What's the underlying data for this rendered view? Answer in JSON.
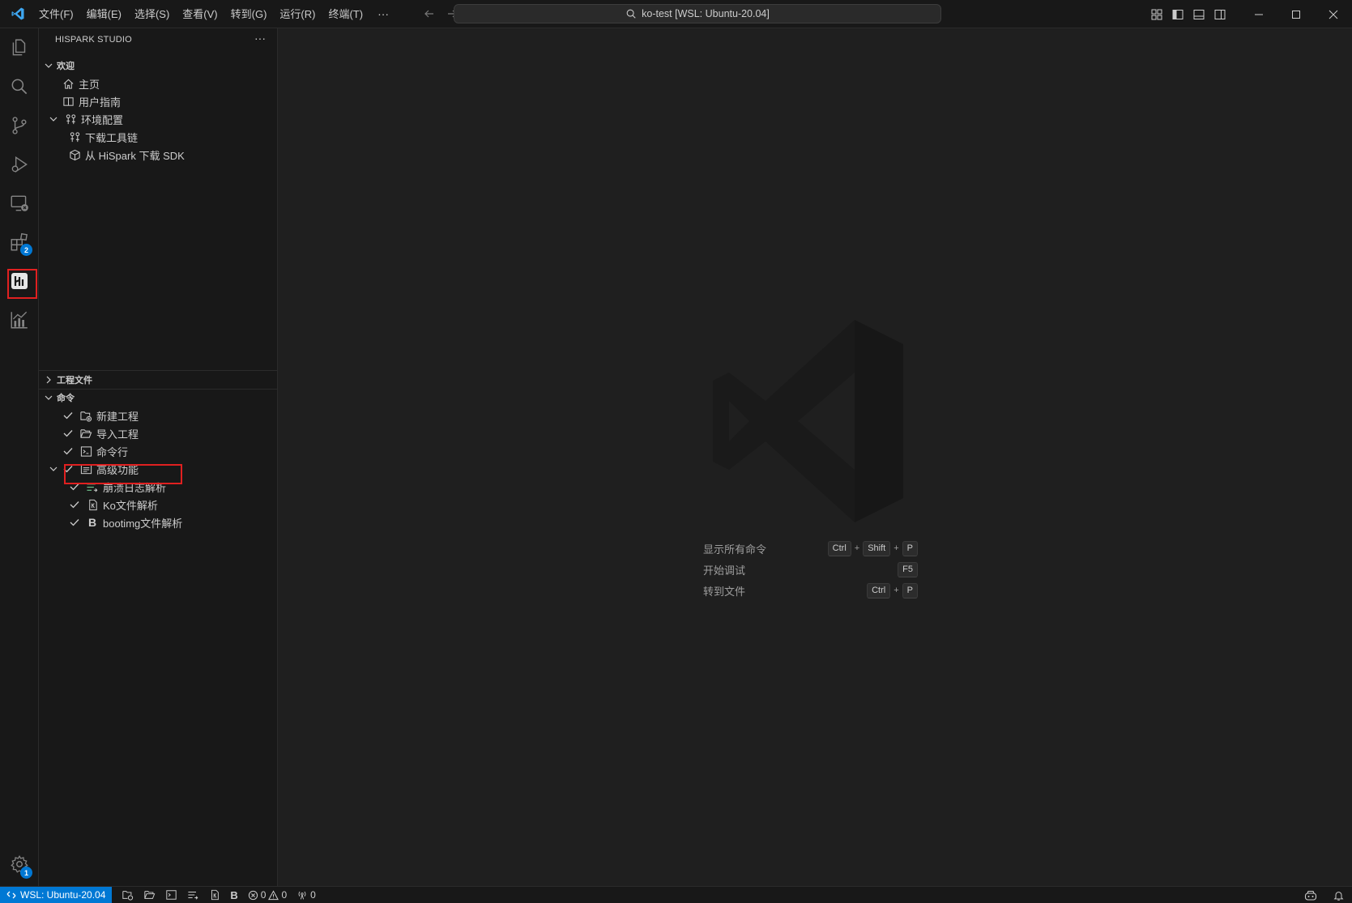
{
  "titlebar": {
    "menu": [
      "文件(F)",
      "编辑(E)",
      "选择(S)",
      "查看(V)",
      "转到(G)",
      "运行(R)",
      "终端(T)"
    ],
    "more": "···",
    "command_center": "ko-test [WSL: Ubuntu-20.04]"
  },
  "activitybar": {
    "items": [
      "explorer-icon",
      "search-icon",
      "source-control-icon",
      "run-debug-icon",
      "remote-explorer-icon",
      "extensions-icon",
      "hispark-icon",
      "chart-icon"
    ],
    "extensions_badge": "2",
    "settings_badge": "1"
  },
  "sidebar": {
    "title": "HISPARK STUDIO",
    "more": "···",
    "welcome": {
      "header": "欢迎",
      "items": [
        {
          "label": "主页",
          "icon": "home-icon"
        },
        {
          "label": "用户指南",
          "icon": "book-icon"
        },
        {
          "label": "环境配置",
          "icon": "settings-group-icon"
        },
        {
          "label": "下载工具链",
          "icon": "tools-icon"
        },
        {
          "label": "从 HiSpark 下载 SDK",
          "icon": "package-icon"
        }
      ]
    },
    "project_files": {
      "header": "工程文件"
    },
    "commands": {
      "header": "命令",
      "items": [
        {
          "label": "新建工程",
          "icon": "new-folder-icon"
        },
        {
          "label": "导入工程",
          "icon": "folder-open-icon"
        },
        {
          "label": "命令行",
          "icon": "terminal-icon"
        },
        {
          "label": "高级功能",
          "icon": "advanced-icon"
        },
        {
          "label": "崩溃日志解析",
          "icon": "log-icon"
        },
        {
          "label": "Ko文件解析",
          "icon": "file-parse-icon"
        },
        {
          "label": "bootimg文件解析",
          "icon": "bold-b-icon"
        }
      ]
    }
  },
  "editor": {
    "shortcuts": [
      {
        "label": "显示所有命令",
        "keys": [
          "Ctrl",
          "Shift",
          "P"
        ]
      },
      {
        "label": "开始调试",
        "keys": [
          "F5"
        ]
      },
      {
        "label": "转到文件",
        "keys": [
          "Ctrl",
          "P"
        ]
      }
    ],
    "key_separator": "+"
  },
  "statusbar": {
    "remote": "WSL: Ubuntu-20.04",
    "errors": "0",
    "warnings": "0",
    "ports": "0",
    "bold_b": "B"
  },
  "colors": {
    "accent": "#0078d4",
    "highlight_box": "#e02020",
    "background": "#1f1f1f",
    "sidebar": "#181818"
  }
}
